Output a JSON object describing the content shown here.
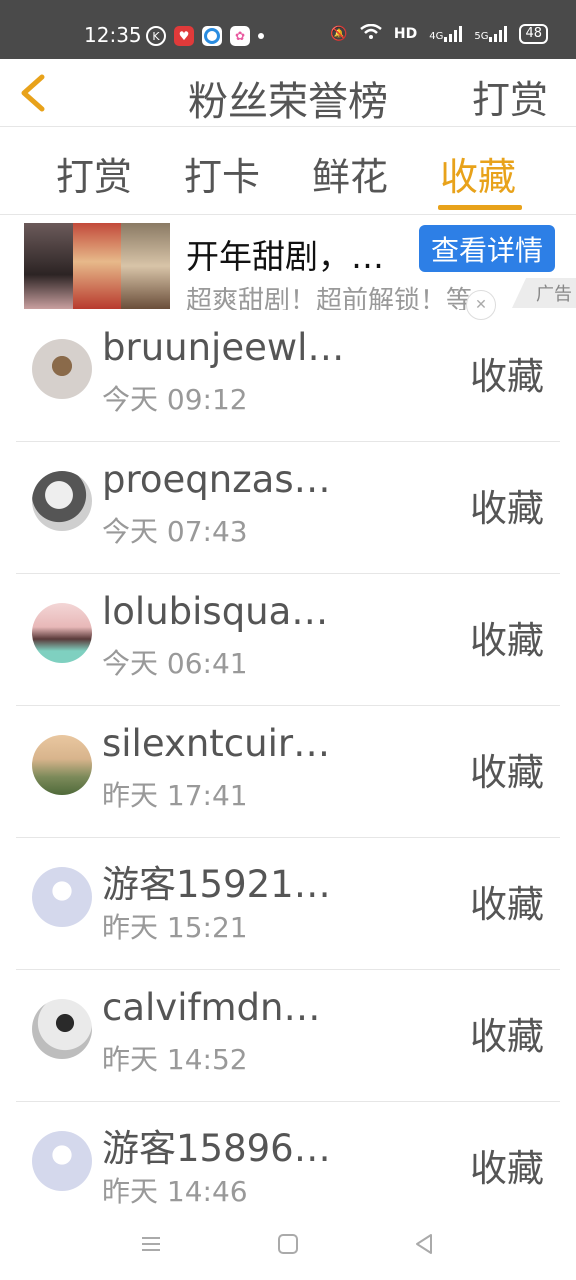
{
  "status_bar": {
    "time": "12:35",
    "network": "HD",
    "signal_1": "4G",
    "signal_2": "5G",
    "battery": "48"
  },
  "header": {
    "back_icon": "chevron-left-icon",
    "title": "粉丝荣誉榜",
    "action_label": "打赏"
  },
  "tabs": [
    {
      "label": "打赏",
      "active": false
    },
    {
      "label": "打卡",
      "active": false
    },
    {
      "label": "鲜花",
      "active": false
    },
    {
      "label": "收藏",
      "active": true
    }
  ],
  "accent_color": "#e8a21a",
  "ad": {
    "title": "开年甜剧，…",
    "button_label": "查看详情",
    "subtitle": "超爽甜剧！超前解锁！等",
    "tag": "广告",
    "close": "✕"
  },
  "items": [
    {
      "name": "bruunjeewl…",
      "time": "今天 09:12",
      "action": "收藏"
    },
    {
      "name": "proeqnzas…",
      "time": "今天 07:43",
      "action": "收藏"
    },
    {
      "name": "lolubisqua…",
      "time": "今天 06:41",
      "action": "收藏"
    },
    {
      "name": "silexntcuir…",
      "time": "昨天 17:41",
      "action": "收藏"
    },
    {
      "name": "游客15921…",
      "time": "昨天 15:21",
      "action": "收藏"
    },
    {
      "name": "calvifmdn…",
      "time": "昨天 14:52",
      "action": "收藏"
    },
    {
      "name": "游客15896…",
      "time": "昨天 14:46",
      "action": "收藏"
    }
  ]
}
